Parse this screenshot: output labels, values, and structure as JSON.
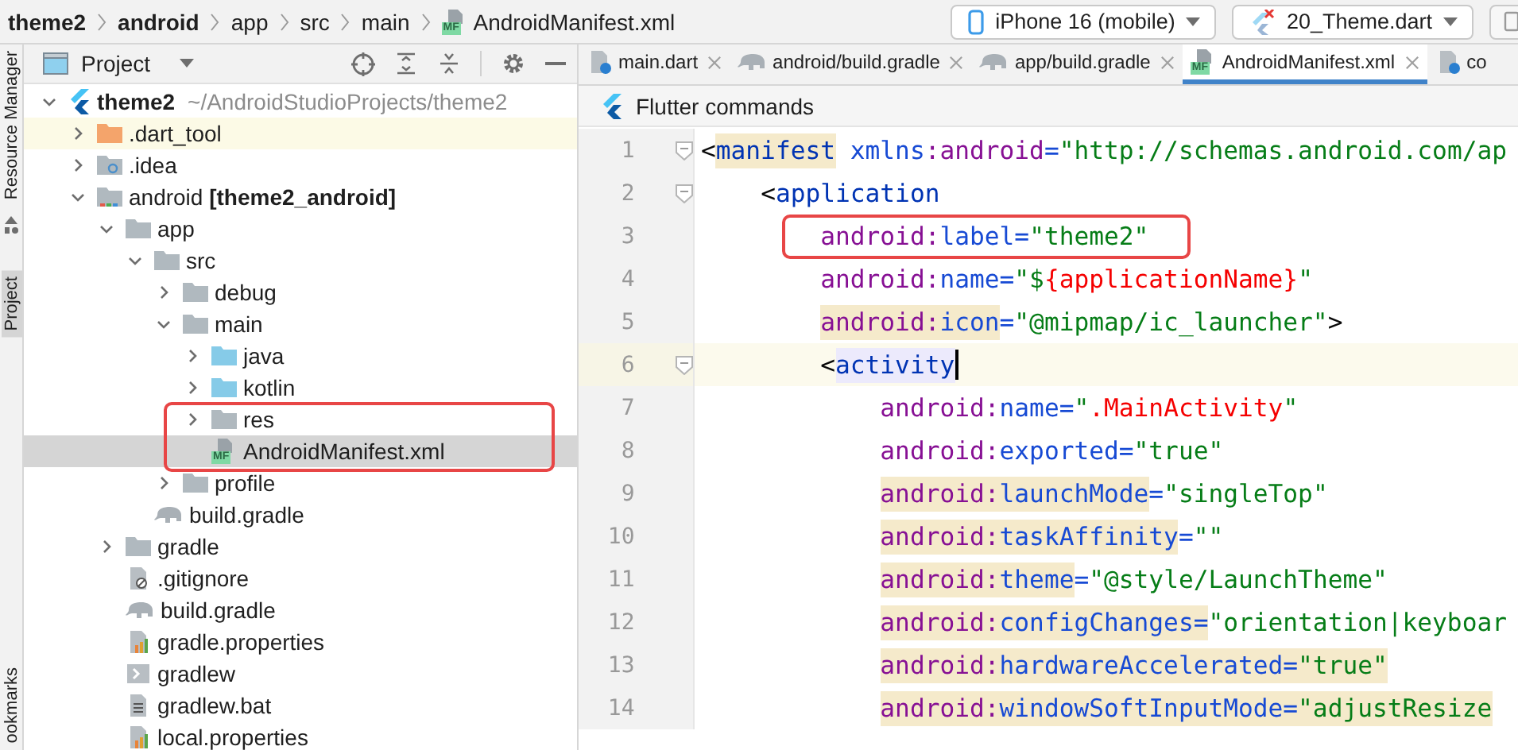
{
  "breadcrumbs": [
    {
      "label": "theme2",
      "bold": true
    },
    {
      "label": "android",
      "bold": true
    },
    {
      "label": "app",
      "bold": false
    },
    {
      "label": "src",
      "bold": false
    },
    {
      "label": "main",
      "bold": false
    },
    {
      "label": "AndroidManifest.xml",
      "bold": false,
      "badge": "MF"
    }
  ],
  "run_toolbar": {
    "device": "iPhone 16 (mobile)",
    "configuration": "20_Theme.dart"
  },
  "side_tabs": [
    {
      "label": "Resource Manager",
      "selected": false
    },
    {
      "label": "Project",
      "selected": true
    },
    {
      "label": "ookmarks",
      "selected": false
    }
  ],
  "project_panel": {
    "title": "Project"
  },
  "project_tree": [
    {
      "label": "theme2",
      "detail": "~/AndroidStudioProjects/theme2",
      "kind": "project",
      "expanded": true,
      "selected": false,
      "annotated": false,
      "children": [
        {
          "label": ".dart_tool",
          "kind": "excluded-folder",
          "expanded": false,
          "selected": false,
          "annotated": false
        },
        {
          "label": ".idea",
          "kind": "settings-folder",
          "expanded": false,
          "selected": false,
          "annotated": false
        },
        {
          "label": "android **[theme2_android]**",
          "kind": "module-folder",
          "expanded": true,
          "selected": false,
          "annotated": false,
          "children": [
            {
              "label": "app",
              "kind": "folder",
              "expanded": true,
              "selected": false,
              "annotated": false,
              "children": [
                {
                  "label": "src",
                  "kind": "folder",
                  "expanded": true,
                  "selected": false,
                  "annotated": false,
                  "children": [
                    {
                      "label": "debug",
                      "kind": "folder",
                      "expanded": false,
                      "selected": false,
                      "annotated": false
                    },
                    {
                      "label": "main",
                      "kind": "folder",
                      "expanded": true,
                      "selected": false,
                      "annotated": false,
                      "children": [
                        {
                          "label": "java",
                          "kind": "source-folder",
                          "expanded": false,
                          "selected": false,
                          "annotated": false
                        },
                        {
                          "label": "kotlin",
                          "kind": "source-folder",
                          "expanded": false,
                          "selected": false,
                          "annotated": false
                        },
                        {
                          "label": "res",
                          "kind": "folder",
                          "expanded": false,
                          "selected": false,
                          "annotated": true
                        },
                        {
                          "label": "AndroidManifest.xml",
                          "kind": "manifest",
                          "badge": "MF",
                          "selected": true,
                          "annotated": true
                        }
                      ]
                    },
                    {
                      "label": "profile",
                      "kind": "folder",
                      "expanded": false,
                      "selected": false,
                      "annotated": false
                    }
                  ]
                },
                {
                  "label": "build.gradle",
                  "kind": "gradle",
                  "selected": false,
                  "annotated": false
                }
              ]
            },
            {
              "label": "gradle",
              "kind": "folder",
              "expanded": false,
              "selected": false,
              "annotated": false
            },
            {
              "label": ".gitignore",
              "kind": "gitignore",
              "selected": false,
              "annotated": false
            },
            {
              "label": "build.gradle",
              "kind": "gradle",
              "selected": false,
              "annotated": false
            },
            {
              "label": "gradle.properties",
              "kind": "properties",
              "selected": false,
              "annotated": false
            },
            {
              "label": "gradlew",
              "kind": "script",
              "selected": false,
              "annotated": false
            },
            {
              "label": "gradlew.bat",
              "kind": "text",
              "selected": false,
              "annotated": false
            },
            {
              "label": "local.properties",
              "kind": "properties",
              "selected": false,
              "annotated": false
            }
          ]
        }
      ]
    }
  ],
  "editor_tabs": [
    {
      "label": "main.dart",
      "kind": "dart",
      "selected": false
    },
    {
      "label": "android/build.gradle",
      "kind": "gradle",
      "selected": false
    },
    {
      "label": "app/build.gradle",
      "kind": "gradle",
      "selected": false
    },
    {
      "label": "AndroidManifest.xml",
      "kind": "manifest",
      "badge": "MF",
      "selected": true
    },
    {
      "label": "co",
      "kind": "dart",
      "selected": false
    }
  ],
  "flutter_bar": {
    "label": "Flutter commands"
  },
  "code_lines": [
    {
      "number": "1",
      "fold": true,
      "current": false,
      "annotated": false,
      "tokens": [
        {
          "kind": "punct",
          "text": "<"
        },
        {
          "kind": "tag",
          "text": "manifest",
          "highlighted": true
        },
        {
          "kind": "attribute",
          "text": " xmlns"
        },
        {
          "kind": "namespace",
          "text": ":android"
        },
        {
          "kind": "attribute",
          "text": "="
        },
        {
          "kind": "value",
          "text": "\"http://schemas.android.com/ap"
        }
      ]
    },
    {
      "number": "2",
      "fold": true,
      "current": false,
      "annotated": false,
      "tokens": [
        {
          "kind": "punct",
          "text": "    <"
        },
        {
          "kind": "tag",
          "text": "application"
        }
      ]
    },
    {
      "number": "3",
      "fold": false,
      "current": false,
      "annotated": true,
      "tokens": [
        {
          "kind": "namespace",
          "text": "        android:"
        },
        {
          "kind": "attribute",
          "text": "label="
        },
        {
          "kind": "value",
          "text": "\"theme2\""
        }
      ]
    },
    {
      "number": "4",
      "fold": false,
      "current": false,
      "annotated": false,
      "tokens": [
        {
          "kind": "namespace",
          "text": "        android:"
        },
        {
          "kind": "attribute",
          "text": "name="
        },
        {
          "kind": "value",
          "text": "\"$"
        },
        {
          "kind": "reference",
          "text": "{applicationName}"
        },
        {
          "kind": "value",
          "text": "\""
        }
      ]
    },
    {
      "number": "5",
      "fold": false,
      "current": false,
      "annotated": false,
      "tokens": [
        {
          "kind": "namespace",
          "text": "        android:",
          "highlighted": true
        },
        {
          "kind": "attribute",
          "text": "icon",
          "highlighted": true
        },
        {
          "kind": "attribute",
          "text": "="
        },
        {
          "kind": "value",
          "text": "\"@mipmap/ic_launcher\""
        },
        {
          "kind": "punct",
          "text": ">"
        }
      ]
    },
    {
      "number": "6",
      "fold": true,
      "current": true,
      "annotated": false,
      "tokens": [
        {
          "kind": "punct",
          "text": "        <"
        },
        {
          "kind": "tag",
          "text": "activity",
          "usage_highlighted": true
        }
      ]
    },
    {
      "number": "7",
      "fold": false,
      "current": false,
      "annotated": false,
      "tokens": [
        {
          "kind": "namespace",
          "text": "            android:"
        },
        {
          "kind": "attribute",
          "text": "name="
        },
        {
          "kind": "value",
          "text": "\""
        },
        {
          "kind": "reference",
          "text": ".MainActivity"
        },
        {
          "kind": "value",
          "text": "\""
        }
      ]
    },
    {
      "number": "8",
      "fold": false,
      "current": false,
      "annotated": false,
      "tokens": [
        {
          "kind": "namespace",
          "text": "            android:"
        },
        {
          "kind": "attribute",
          "text": "exported="
        },
        {
          "kind": "value",
          "text": "\"true\""
        }
      ]
    },
    {
      "number": "9",
      "fold": false,
      "current": false,
      "annotated": false,
      "tokens": [
        {
          "kind": "namespace",
          "text": "            android:",
          "highlighted": true
        },
        {
          "kind": "attribute",
          "text": "launchMode",
          "highlighted": true
        },
        {
          "kind": "attribute",
          "text": "="
        },
        {
          "kind": "value",
          "text": "\"singleTop\""
        }
      ]
    },
    {
      "number": "10",
      "fold": false,
      "current": false,
      "annotated": false,
      "tokens": [
        {
          "kind": "namespace",
          "text": "            android:",
          "highlighted": true
        },
        {
          "kind": "attribute",
          "text": "taskAffinity",
          "highlighted": true
        },
        {
          "kind": "attribute",
          "text": "="
        },
        {
          "kind": "value",
          "text": "\"\""
        }
      ]
    },
    {
      "number": "11",
      "fold": false,
      "current": false,
      "annotated": false,
      "tokens": [
        {
          "kind": "namespace",
          "text": "            android:",
          "highlighted": true
        },
        {
          "kind": "attribute",
          "text": "theme",
          "highlighted": true
        },
        {
          "kind": "attribute",
          "text": "="
        },
        {
          "kind": "value",
          "text": "\"@style/LaunchTheme\""
        }
      ]
    },
    {
      "number": "12",
      "fold": false,
      "current": false,
      "annotated": false,
      "tokens": [
        {
          "kind": "namespace",
          "text": "            android:",
          "highlighted": true
        },
        {
          "kind": "attribute",
          "text": "configChanges=",
          "highlighted": true
        },
        {
          "kind": "value",
          "text": "\"orientation|keyboar"
        }
      ]
    },
    {
      "number": "13",
      "fold": false,
      "current": false,
      "annotated": false,
      "tokens": [
        {
          "kind": "namespace",
          "text": "            android:",
          "highlighted": true
        },
        {
          "kind": "attribute",
          "text": "hardwareAccelerated=",
          "highlighted": true
        },
        {
          "kind": "value",
          "text": "\"true\"",
          "highlighted": true
        }
      ]
    },
    {
      "number": "14",
      "fold": false,
      "current": false,
      "annotated": false,
      "tokens": [
        {
          "kind": "namespace",
          "text": "            android:",
          "highlighted": true
        },
        {
          "kind": "attribute",
          "text": "windowSoftInputMode=",
          "highlighted": true
        },
        {
          "kind": "value",
          "text": "\"adjustResize",
          "highlighted": true
        }
      ]
    }
  ]
}
